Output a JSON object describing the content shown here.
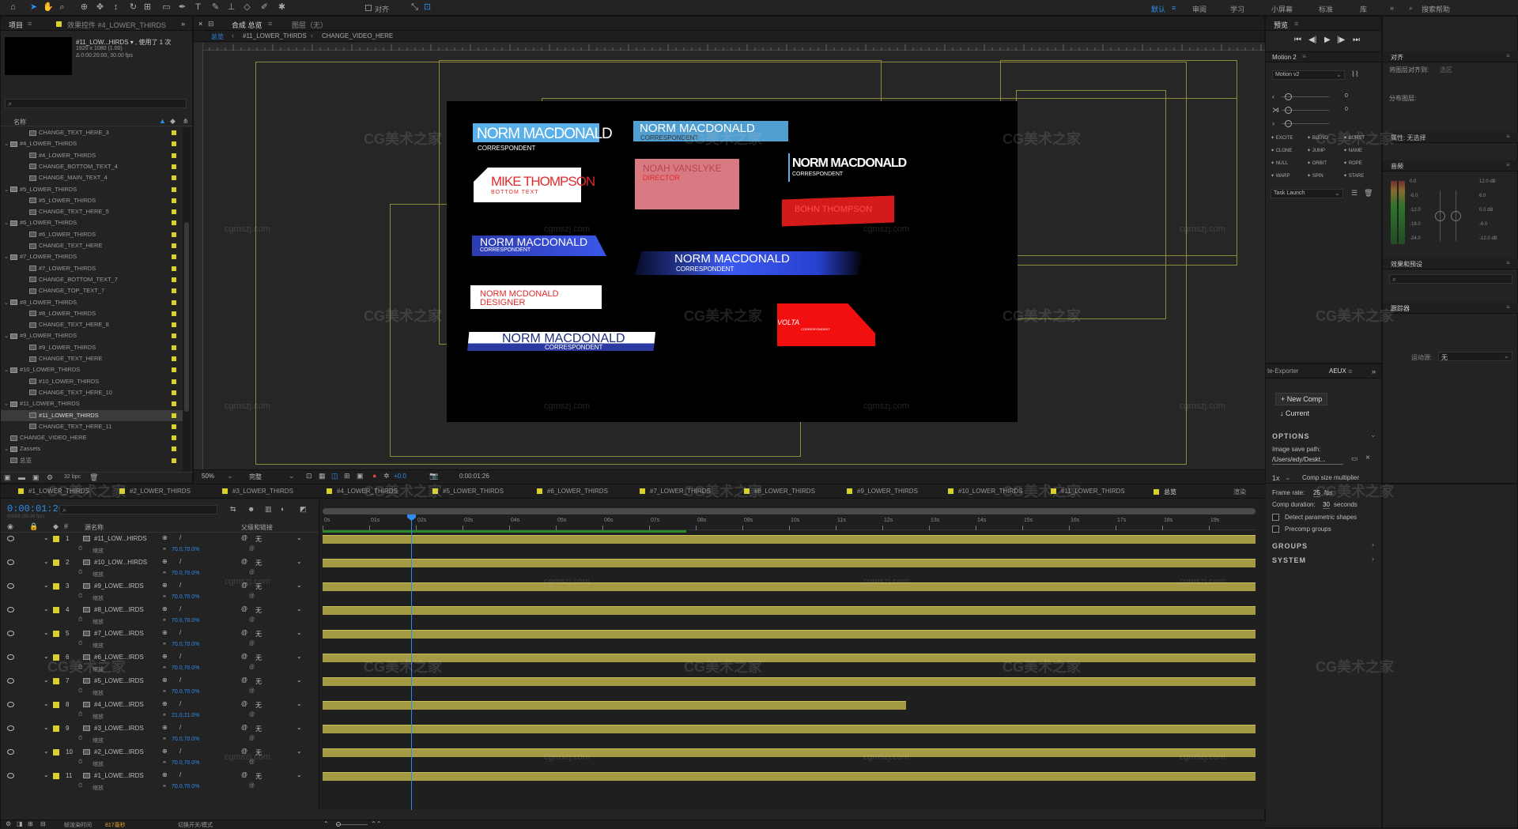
{
  "toolbar": {
    "workspaces": [
      "默认",
      "审阅",
      "学习",
      "小屏幕",
      "标准",
      "库"
    ],
    "search": "搜索帮助",
    "snap": "对齐"
  },
  "project": {
    "tab": "项目",
    "effects_tab": "效果控件 #4_LOWER_THIRDS",
    "comp_name": "#11_LOW...HIRDS ▾ , 使用了 1 次",
    "comp_size": "1920 x 1080 (1.00)",
    "comp_duration": "Δ 0:00:20:00, 30.00 fps",
    "col_name": "名称",
    "bpc": "32 bpc",
    "items": [
      {
        "name": "CHANGE_TEXT_HERE_3",
        "type": "comp",
        "indent": 2
      },
      {
        "name": "#4_LOWER_THIRDS",
        "type": "folder",
        "indent": 0
      },
      {
        "name": "#4_LOWER_THIRDS",
        "type": "comp",
        "indent": 2
      },
      {
        "name": "CHANGE_BOTTOM_TEXT_4",
        "type": "comp",
        "indent": 2
      },
      {
        "name": "CHANGE_MAIN_TEXT_4",
        "type": "comp",
        "indent": 2
      },
      {
        "name": "#5_LOWER_THIRDS",
        "type": "folder",
        "indent": 0
      },
      {
        "name": "#5_LOWER_THIRDS",
        "type": "comp",
        "indent": 2
      },
      {
        "name": "CHANGE_TEXT_HERE_5",
        "type": "comp",
        "indent": 2
      },
      {
        "name": "#6_LOWER_THIRDS",
        "type": "folder",
        "indent": 0
      },
      {
        "name": "#6_LOWER_THIRDS",
        "type": "comp",
        "indent": 2
      },
      {
        "name": "CHANGE_TEXT_HERE",
        "type": "comp",
        "indent": 2
      },
      {
        "name": "#7_LOWER_THIRDS",
        "type": "folder",
        "indent": 0
      },
      {
        "name": "#7_LOWER_THIRDS",
        "type": "comp",
        "indent": 2
      },
      {
        "name": "CHANGE_BOTTOM_TEXT_7",
        "type": "comp",
        "indent": 2
      },
      {
        "name": "CHANGE_TOP_TEXT_7",
        "type": "comp",
        "indent": 2
      },
      {
        "name": "#8_LOWER_THIRDS",
        "type": "folder",
        "indent": 0
      },
      {
        "name": "#8_LOWER_THIRDS",
        "type": "comp",
        "indent": 2
      },
      {
        "name": "CHANGE_TEXT_HERE_8",
        "type": "comp",
        "indent": 2
      },
      {
        "name": "#9_LOWER_THIRDS",
        "type": "folder",
        "indent": 0
      },
      {
        "name": "#9_LOWER_THIRDS",
        "type": "comp",
        "indent": 2
      },
      {
        "name": "CHANGE_TEXT_HERE",
        "type": "comp",
        "indent": 2
      },
      {
        "name": "#10_LOWER_THIRDS",
        "type": "folder",
        "indent": 0
      },
      {
        "name": "#10_LOWER_THIRDS",
        "type": "comp",
        "indent": 2
      },
      {
        "name": "CHANGE_TEXT_HERE_10",
        "type": "comp",
        "indent": 2
      },
      {
        "name": "#11_LOWER_THIRDS",
        "type": "folder",
        "indent": 0
      },
      {
        "name": "#11_LOWER_THIRDS",
        "type": "comp",
        "indent": 2,
        "selected": true
      },
      {
        "name": "CHANGE_TEXT_HERE_11",
        "type": "comp",
        "indent": 2
      },
      {
        "name": "CHANGE_VIDEO_HERE",
        "type": "comp",
        "indent": 0
      },
      {
        "name": "Zassets",
        "type": "folder",
        "indent": 0
      },
      {
        "name": "总览",
        "type": "comp",
        "indent": 0
      }
    ]
  },
  "composition": {
    "tab": "合成 总览",
    "layer_tab": "图层（无）",
    "breadcrumbs": [
      "总览",
      "#11_LOWER_THIRDS",
      "CHANGE_VIDEO_HERE"
    ],
    "zoom": "50%",
    "quality": "完整",
    "timecode": "0:00:01:26",
    "exposure": "+0.0"
  },
  "lower_thirds": {
    "a_name": "NORM MACDONALD",
    "a_title": "CORRESPONDENT",
    "b_name": "NORM MACDONALD",
    "b_title": "CORRESPONDENT",
    "c_name": "NORM MACDONALD",
    "c_title": "CORRESPONDENT",
    "d_name": "MIKE THOMPSON",
    "d_title": "BOTTOM TEXT",
    "e_name": "NOAH VANSLYKE",
    "e_title": "DIRECTOR",
    "f_name": "BOHN THOMPSON",
    "g_name": "NORM MACDONALD",
    "g_title": "CORRESPONDENT",
    "h_name": "NORM MACDONALD",
    "h_title": "CORRESPONDENT",
    "i_name": "NORM MCDONALD",
    "i_title": "DESIGNER",
    "j_name": "NORM MACDONALD",
    "j_title": "CORRESPONDENT",
    "k_name": "VOLTA",
    "k_title": "CORRESPONDENT"
  },
  "watermark": {
    "cn": "CG美术之家",
    "url": "cgmszj.com"
  },
  "timeline": {
    "timecode": "0:00:01:26",
    "frame_hint": "00056 (30.00 fps)",
    "col_source": "源名称",
    "col_parent": "父级和链接",
    "footer_render": "帧渲染时间",
    "footer_ms": "817毫秒",
    "footer_switch": "切换开关/模式",
    "tabs": [
      "#1_LOWER_THIRDS",
      "#2_LOWER_THIRDS",
      "#3_LOWER_THIRDS",
      "#4_LOWER_THIRDS",
      "#5_LOWER_THIRDS",
      "#6_LOWER_THIRDS",
      "#7_LOWER_THIRDS",
      "#8_LOWER_THIRDS",
      "#9_LOWER_THIRDS",
      "#10_LOWER_THIRDS",
      "#11_LOWER_THIRDS",
      "总览",
      "渲染"
    ],
    "ruler": [
      "0s",
      "01s",
      "02s",
      "03s",
      "04s",
      "05s",
      "06s",
      "07s",
      "08s",
      "09s",
      "10s",
      "11s",
      "12s",
      "13s",
      "14s",
      "15s",
      "16s",
      "17s",
      "18s",
      "19s"
    ],
    "duration_seconds": 20,
    "playhead_seconds": 1.9,
    "layers": [
      {
        "num": "1",
        "name": "#11_LOW...HIRDS",
        "parent": "无",
        "scale": "70.0,70.0%",
        "start": 0,
        "end": 20
      },
      {
        "num": "2",
        "name": "#10_LOW...HIRDS",
        "parent": "无",
        "scale": "70.0,70.0%",
        "start": 0,
        "end": 20
      },
      {
        "num": "3",
        "name": "#9_LOWE...IRDS",
        "parent": "无",
        "scale": "70.0,70.0%",
        "start": 0,
        "end": 20
      },
      {
        "num": "4",
        "name": "#8_LOWE...IRDS",
        "parent": "无",
        "scale": "70.0,70.0%",
        "start": 0,
        "end": 20
      },
      {
        "num": "5",
        "name": "#7_LOWE...IRDS",
        "parent": "无",
        "scale": "70.0,70.0%",
        "start": 0,
        "end": 20
      },
      {
        "num": "6",
        "name": "#6_LOWE...IRDS",
        "parent": "无",
        "scale": "70.0,70.0%",
        "start": 0,
        "end": 20
      },
      {
        "num": "7",
        "name": "#5_LOWE...IRDS",
        "parent": "无",
        "scale": "70.0,70.0%",
        "start": 0,
        "end": 20
      },
      {
        "num": "8",
        "name": "#4_LOWE...IRDS",
        "parent": "无",
        "scale": "21.0,21.0%",
        "start": 0,
        "end": 12.5
      },
      {
        "num": "9",
        "name": "#3_LOWE...IRDS",
        "parent": "无",
        "scale": "70.0,70.0%",
        "start": 0,
        "end": 20
      },
      {
        "num": "10",
        "name": "#2_LOWE...IRDS",
        "parent": "无",
        "scale": "70.0,70.0%",
        "start": 0,
        "end": 20
      },
      {
        "num": "11",
        "name": "#1_LOWE...IRDS",
        "parent": "无",
        "scale": "70.0,70.0%",
        "start": 0,
        "end": 20
      }
    ],
    "scale_label": "缩放"
  },
  "preview": {
    "tab": "预览"
  },
  "motion": {
    "tab": "Motion 2",
    "version": "Motion v2",
    "val1": "0",
    "val2": "0",
    "buttons": [
      "EXCITE",
      "BLEND",
      "BURST",
      "CLONE",
      "JUMP",
      "NAME",
      "NULL",
      "ORBIT",
      "ROPE",
      "WARP",
      "SPIN",
      "STARE"
    ],
    "task": "Task Launch"
  },
  "align": {
    "tab": "对齐",
    "align_to": "将图层对齐到:",
    "align_target": "选区",
    "distribute": "分布图层:"
  },
  "side": {
    "props": "属性: 无选择",
    "audio": "音频",
    "effects": "效果和预设",
    "tracker": "跟踪器",
    "motion_source": "运动源:",
    "motion_source_val": "无",
    "audio_left": [
      "0.0",
      "-6.0",
      "-12.0",
      "-18.0",
      "-24.0"
    ],
    "audio_right": [
      "12.0 dB",
      "6.0",
      "0.0 dB",
      "-6.0",
      "-12.0 dB"
    ]
  },
  "aeux": {
    "tab_left": "te-Exporter",
    "tab": "AEUX",
    "new_comp": "+ New Comp",
    "current": "↓ Current",
    "options": "OPTIONS",
    "image_path_label": "Image save path:",
    "image_path": "/Users/edy/Deskt...",
    "multiplier_val": "1x",
    "multiplier_label": "Comp size multiplier",
    "frame_rate_label": "Frame rate:",
    "frame_rate": "25",
    "fps": "fps",
    "duration_label": "Comp duration:",
    "duration": "30",
    "seconds": "seconds",
    "detect": "Detect parametric shapes",
    "precomp": "Precomp groups",
    "groups": "GROUPS",
    "system": "SYSTEM"
  }
}
